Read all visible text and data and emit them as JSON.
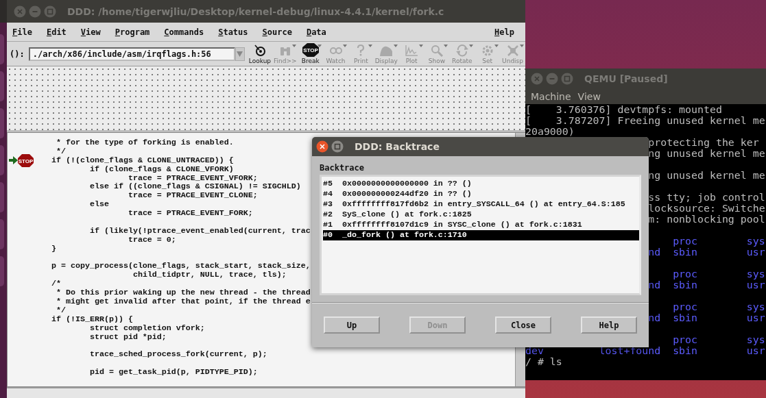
{
  "ddd_window": {
    "title": "DDD: /home/tigerwjliu/Desktop/kernel-debug/linux-4.4.1/kernel/fork.c",
    "active": false,
    "menu": [
      {
        "label": "File"
      },
      {
        "label": "Edit"
      },
      {
        "label": "View"
      },
      {
        "label": "Program"
      },
      {
        "label": "Commands"
      },
      {
        "label": "Status"
      },
      {
        "label": "Source"
      },
      {
        "label": "Data"
      }
    ],
    "help_menu": "Help",
    "toolbar": {
      "argument_label": "():",
      "argument_value": "./arch/x86/include/asm/irqflags.h:56",
      "tools": [
        {
          "label": "Lookup",
          "kind": "lookup",
          "disabled": false,
          "has_menu": false
        },
        {
          "label": "Find>>",
          "kind": "find",
          "disabled": true,
          "has_menu": true
        },
        {
          "label": "Break",
          "kind": "break",
          "disabled": false,
          "has_menu": true,
          "badge": "STOP"
        },
        {
          "label": "Watch",
          "kind": "watch",
          "disabled": true,
          "has_menu": true
        },
        {
          "label": "Print",
          "kind": "print",
          "disabled": true,
          "has_menu": true
        },
        {
          "label": "Display",
          "kind": "display",
          "disabled": true,
          "has_menu": true
        },
        {
          "label": "Plot",
          "kind": "plot",
          "disabled": true,
          "has_menu": true
        },
        {
          "label": "Show",
          "kind": "show",
          "disabled": true,
          "has_menu": true
        },
        {
          "label": "Rotate",
          "kind": "rotate",
          "disabled": true,
          "has_menu": true
        },
        {
          "label": "Set",
          "kind": "set",
          "disabled": true,
          "has_menu": true
        },
        {
          "label": "Undisp",
          "kind": "undisp",
          "disabled": true,
          "has_menu": true
        }
      ]
    },
    "source": {
      "breakpoint_label": "STOP",
      "lines": [
        {
          "text": "\t * for the type of forking is enabled.",
          "breakpoint": false,
          "current": false
        },
        {
          "text": "\t */",
          "breakpoint": false,
          "current": false
        },
        {
          "text": "\tif (!(clone_flags & CLONE_UNTRACED)) {",
          "breakpoint": true,
          "current": true
        },
        {
          "text": "\t\tif (clone_flags & CLONE_VFORK)",
          "breakpoint": false,
          "current": false
        },
        {
          "text": "\t\t\ttrace = PTRACE_EVENT_VFORK;",
          "breakpoint": false,
          "current": false
        },
        {
          "text": "\t\telse if ((clone_flags & CSIGNAL) != SIGCHLD)",
          "breakpoint": false,
          "current": false
        },
        {
          "text": "\t\t\ttrace = PTRACE_EVENT_CLONE;",
          "breakpoint": false,
          "current": false
        },
        {
          "text": "\t\telse",
          "breakpoint": false,
          "current": false
        },
        {
          "text": "\t\t\ttrace = PTRACE_EVENT_FORK;",
          "breakpoint": false,
          "current": false
        },
        {
          "breakpoint": false,
          "current": false
        },
        {
          "text": "\t\tif (likely(!ptrace_event_enabled(current, trac",
          "breakpoint": false,
          "current": false
        },
        {
          "text": "\t\t\ttrace = 0;",
          "breakpoint": false,
          "current": false
        },
        {
          "text": "\t}",
          "breakpoint": false,
          "current": false
        },
        {
          "breakpoint": false,
          "current": false
        },
        {
          "text": "\tp = copy_process(clone_flags, stack_start, stack_size,",
          "breakpoint": false,
          "current": false
        },
        {
          "text": "\t\t\t child_tidptr, NULL, trace, tls);",
          "breakpoint": false,
          "current": false
        },
        {
          "text": "\t/*",
          "breakpoint": false,
          "current": false
        },
        {
          "text": "\t * Do this prior waking up the new thread - the thread",
          "breakpoint": false,
          "current": false
        },
        {
          "text": "\t * might get invalid after that point, if the thread e",
          "breakpoint": false,
          "current": false
        },
        {
          "text": "\t */",
          "breakpoint": false,
          "current": false
        },
        {
          "text": "\tif (!IS_ERR(p)) {",
          "breakpoint": false,
          "current": false
        },
        {
          "text": "\t\tstruct completion vfork;",
          "breakpoint": false,
          "current": false
        },
        {
          "text": "\t\tstruct pid *pid;",
          "breakpoint": false,
          "current": false
        },
        {
          "breakpoint": false,
          "current": false
        },
        {
          "text": "\t\ttrace_sched_process_fork(current, p);",
          "breakpoint": false,
          "current": false
        },
        {
          "breakpoint": false,
          "current": false
        },
        {
          "text": "\t\tpid = get_task_pid(p, PIDTYPE_PID);",
          "breakpoint": false,
          "current": false
        }
      ]
    }
  },
  "qemu_window": {
    "title": "QEMU [Paused]",
    "active": false,
    "menu": [
      {
        "label": "Machine"
      },
      {
        "label": "View"
      }
    ],
    "terminal": [
      {
        "kind": "log",
        "text": "[    3.760376] devtmpfs: mounted",
        "covered": false
      },
      {
        "kind": "log",
        "text": "[    3.787207] Freeing unused kernel me",
        "covered": false
      },
      {
        "kind": "log",
        "text": "20a9000)",
        "covered": false
      },
      {
        "kind": "log",
        "text": "protecting the ker",
        "covered": true
      },
      {
        "kind": "log",
        "text": "ng unused kernel me",
        "covered": true
      },
      {
        "kind": "blank"
      },
      {
        "kind": "log",
        "text": "ng unused kernel me",
        "covered": true
      },
      {
        "kind": "blank"
      },
      {
        "kind": "log",
        "text": "ss tty; job control",
        "covered": true
      },
      {
        "kind": "log",
        "text": "locksource: Switche",
        "covered": true
      },
      {
        "kind": "log",
        "text": "m: nonblocking pool",
        "covered": true
      },
      {
        "kind": "blank"
      },
      {
        "kind": "listing",
        "column_3": "proc",
        "column_4": "sys"
      },
      {
        "kind": "listing",
        "column_2": "nd",
        "column_3": "sbin",
        "column_4": "usr",
        "covered": true
      },
      {
        "kind": "blank"
      },
      {
        "kind": "listing",
        "column_3": "proc",
        "column_4": "sys"
      },
      {
        "kind": "listing",
        "column_2": "nd",
        "column_3": "sbin",
        "column_4": "usr",
        "covered": true
      },
      {
        "kind": "blank"
      },
      {
        "kind": "listing",
        "column_3": "proc",
        "column_4": "sys"
      },
      {
        "kind": "listing",
        "column_2": "nd",
        "column_3": "sbin",
        "column_4": "usr",
        "covered": true
      },
      {
        "kind": "blank"
      },
      {
        "kind": "listing",
        "column_3": "proc",
        "column_4": "sys"
      },
      {
        "kind": "listing",
        "column_1": "dev",
        "column_2": "lost+found",
        "column_3": "sbin",
        "column_4": "usr",
        "covered": false
      },
      {
        "kind": "log",
        "text": "/ # ls",
        "covered": false
      }
    ]
  },
  "backtrace_dialog": {
    "title": "DDD: Backtrace",
    "active": true,
    "list_label": "Backtrace",
    "frames": [
      {
        "number": "#5",
        "location": "0x0000000000000000 in ?? ()",
        "selected": false
      },
      {
        "number": "#4",
        "location": "0x000000000244df20 in ?? ()",
        "selected": false
      },
      {
        "number": "#3",
        "location": "0xffffffff817fd6b2 in entry_SYSCALL_64 () at entry_64.S:185",
        "selected": false
      },
      {
        "number": "#2",
        "location": "SyS_clone () at fork.c:1825",
        "selected": false
      },
      {
        "number": "#1",
        "location": "0xffffffff8107d1c9 in SYSC_clone () at fork.c:1831",
        "selected": false
      },
      {
        "number": "#0",
        "location": "_do_fork () at fork.c:1710",
        "selected": true
      }
    ],
    "buttons": [
      {
        "label": "Up",
        "disabled": false
      },
      {
        "label": "Down",
        "disabled": true
      },
      {
        "label": "Close",
        "disabled": false
      },
      {
        "label": "Help",
        "disabled": false
      }
    ]
  }
}
